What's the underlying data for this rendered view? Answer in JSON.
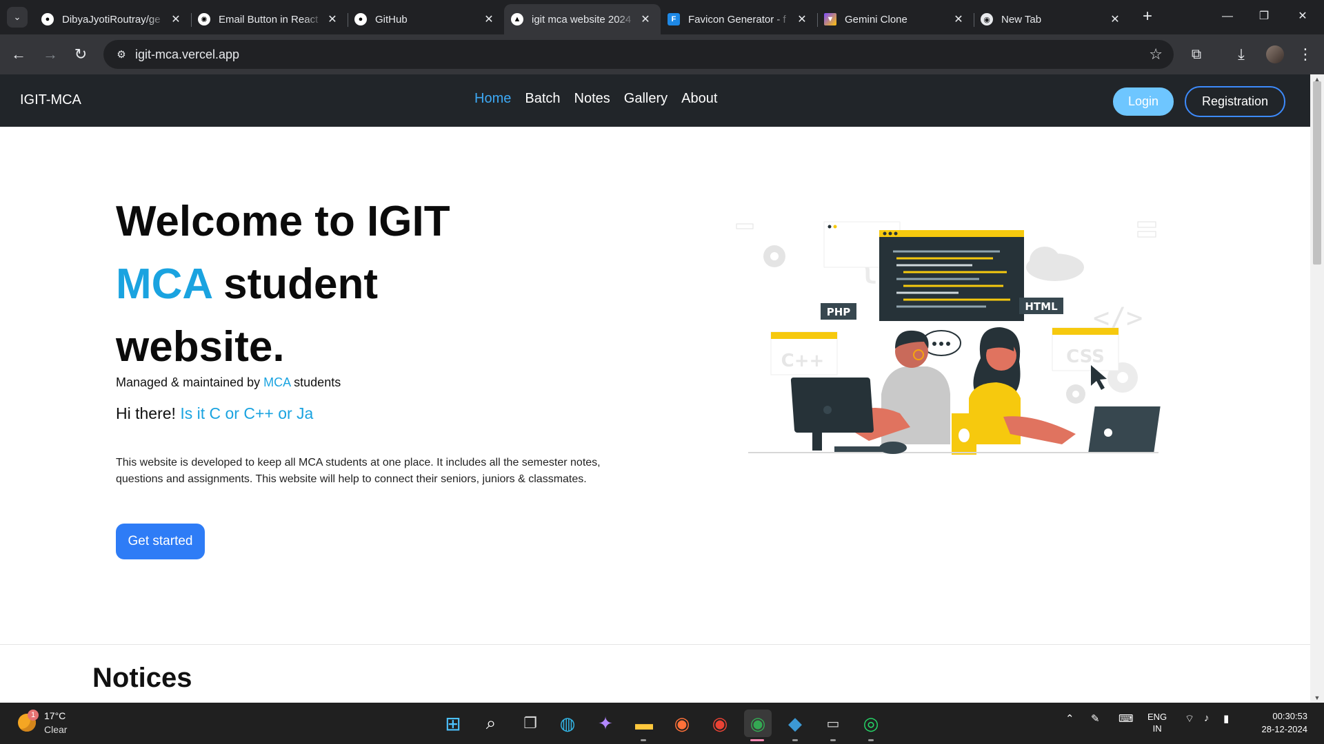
{
  "browser": {
    "tabs": [
      {
        "title": "DibyaJyotiRoutray/ge",
        "icon": "github-icon",
        "active": false
      },
      {
        "title": "Email Button in React",
        "icon": "openai-icon",
        "active": false
      },
      {
        "title": "GitHub",
        "icon": "github-icon",
        "active": false
      },
      {
        "title": "igit mca website 2024",
        "icon": "vercel-icon",
        "active": true
      },
      {
        "title": "Favicon Generator - f",
        "icon": "favicon-generator-icon",
        "active": false
      },
      {
        "title": "Gemini Clone",
        "icon": "vite-icon",
        "active": false
      },
      {
        "title": "New Tab",
        "icon": "chrome-icon",
        "active": false
      }
    ],
    "url": "igit-mca.vercel.app"
  },
  "site": {
    "brand": "IGIT-MCA",
    "nav": [
      "Home",
      "Batch",
      "Notes",
      "Gallery",
      "About"
    ],
    "nav_active": "Home",
    "login_label": "Login",
    "register_label": "Registration",
    "accent_color": "#1aa3e0"
  },
  "hero": {
    "title_line1": "Welcome to IGIT",
    "title_accent": "MCA",
    "title_line2_rest": " student",
    "title_line3": "website.",
    "managed_prefix": "Managed & maintained by ",
    "managed_accent": "MCA",
    "managed_suffix": " students",
    "typed_prefix": "Hi there! ",
    "typed_text": "Is it C or C++ or Ja",
    "description": "This website is developed to keep all MCA students at one place. It includes all the semester notes, questions and assignments. This website will help to connect their seniors, juniors & classmates.",
    "cta_label": "Get started"
  },
  "illustration": {
    "labels": [
      "PHP",
      "HTML",
      "C++",
      "CSS"
    ]
  },
  "notices_heading": "Notices",
  "taskbar": {
    "weather_badge": "1",
    "temperature": "17°C",
    "condition": "Clear",
    "language": "ENG",
    "region": "IN",
    "time": "00:30:53",
    "date": "28-12-2024"
  }
}
